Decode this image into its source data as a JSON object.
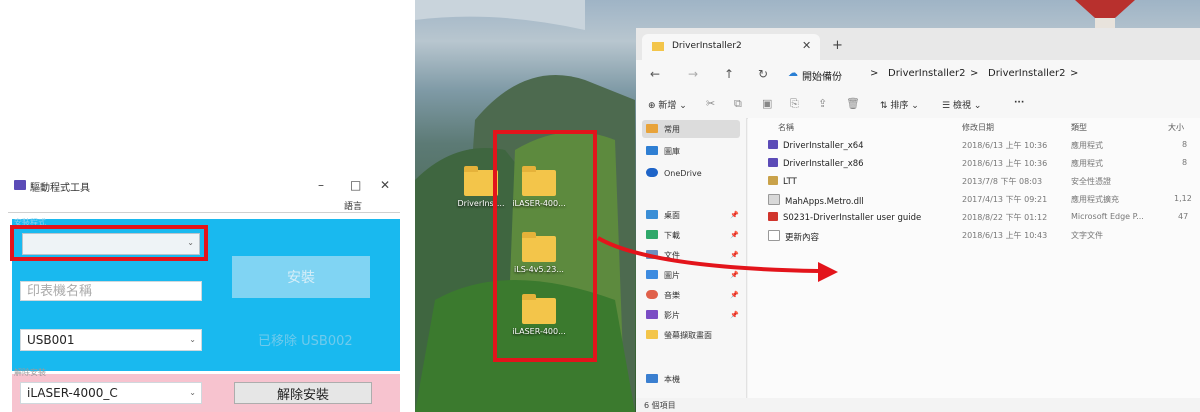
{
  "tool": {
    "title": "驅動程式工具",
    "win_min": "–",
    "win_max": "□",
    "win_close": "✕",
    "menu_language": "語言",
    "group_install_label": "安裝程式",
    "install_button": "安裝",
    "printer_name_placeholder": "印表機名稱",
    "port_value": "USB001",
    "removed_status": "已移除 USB002",
    "group_uninstall_label": "解除安裝",
    "model_value": "iLASER-4000_C",
    "uninstall_button": "解除安裝",
    "chevron": "⌄"
  },
  "desktop": {
    "icons": [
      {
        "label": "DriverInst..."
      },
      {
        "label": "iLASER-400..."
      },
      {
        "label": "iLS-4v5.23..."
      },
      {
        "label": "iLASER-400..."
      }
    ]
  },
  "explorer": {
    "tab_title": "DriverInstaller2",
    "tab_close": "✕",
    "new_tab": "+",
    "nav": {
      "back": "←",
      "forward": "→",
      "up": "↑",
      "refresh": "↻"
    },
    "breadcrumbs": [
      "開始備份",
      ">",
      "DriverInstaller2",
      ">",
      "DriverInstaller2",
      ">"
    ],
    "toolbar": {
      "new": "新增",
      "sort": "排序",
      "view": "檢視",
      "more": "···"
    },
    "sidebar": [
      {
        "label": "常用",
        "icon": "home-icon"
      },
      {
        "label": "圖庫",
        "icon": "gallery-icon"
      },
      {
        "label": "OneDrive",
        "icon": "cloud-icon"
      },
      {
        "label": "桌面",
        "icon": "desktop-icon"
      },
      {
        "label": "下載",
        "icon": "download-icon"
      },
      {
        "label": "文件",
        "icon": "documents-icon"
      },
      {
        "label": "圖片",
        "icon": "pictures-icon"
      },
      {
        "label": "音樂",
        "icon": "music-icon"
      },
      {
        "label": "影片",
        "icon": "videos-icon"
      },
      {
        "label": "螢幕擷取畫面",
        "icon": "folder-icon"
      },
      {
        "label": "本機",
        "icon": "computer-icon"
      }
    ],
    "columns": {
      "name": "名稱",
      "date": "修改日期",
      "type": "類型",
      "size": "大小"
    },
    "files": [
      {
        "name": "DriverInstaller_x64",
        "date": "2018/6/13 上午 10:36",
        "type": "應用程式",
        "size": "8"
      },
      {
        "name": "DriverInstaller_x86",
        "date": "2018/6/13 上午 10:36",
        "type": "應用程式",
        "size": "8"
      },
      {
        "name": "LTT",
        "date": "2013/7/8 下午 08:03",
        "type": "安全性憑證",
        "size": ""
      },
      {
        "name": "MahApps.Metro.dll",
        "date": "2017/4/13 下午 09:21",
        "type": "應用程式擴充",
        "size": "1,12"
      },
      {
        "name": "S0231-DriverInstaller user guide",
        "date": "2018/8/22 下午 01:12",
        "type": "Microsoft Edge P...",
        "size": "47"
      },
      {
        "name": "更新內容",
        "date": "2018/6/13 上午 10:43",
        "type": "文字文件",
        "size": ""
      }
    ],
    "status": "6 個項目"
  },
  "colors": {
    "highlight_red": "#e3141b",
    "install_panel_blue": "#19b9ef",
    "uninstall_panel_pink": "#f7c3cf"
  }
}
